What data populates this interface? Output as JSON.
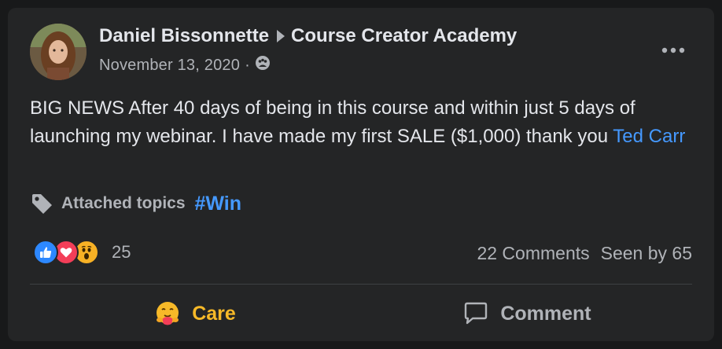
{
  "post": {
    "author": "Daniel Bissonnette",
    "group": "Course Creator Academy",
    "date": "November 13, 2020",
    "separator": "·",
    "privacy_icon": "members-icon",
    "text_main": "BIG NEWS After 40 days of being in this course and within just 5 days of launching my webinar. I have made my first SALE ($1,000) thank you ",
    "mention": "Ted Carr",
    "topics_label": "Attached topics",
    "topic": "#Win"
  },
  "engagement": {
    "reaction_icons": [
      "like-icon",
      "love-icon",
      "wow-icon"
    ],
    "reaction_count": "25",
    "comments": "22 Comments",
    "seen": "Seen by 65"
  },
  "actions": {
    "care_label": "Care",
    "comment_label": "Comment"
  },
  "colors": {
    "background": "#242526",
    "link": "#4599ff",
    "care": "#f7b928",
    "muted": "#b0b3b8"
  }
}
